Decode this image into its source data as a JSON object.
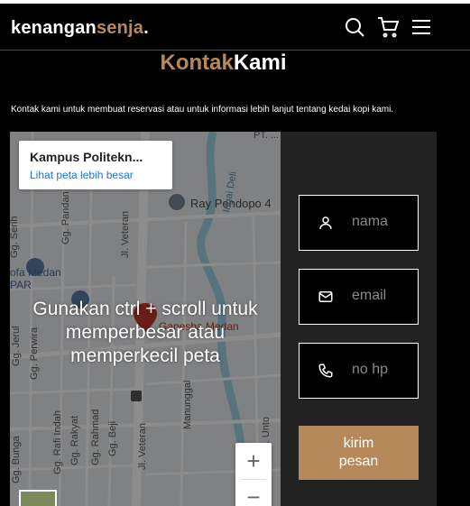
{
  "brand": {
    "part1": "kenangan",
    "part2": "senja",
    "dot": "."
  },
  "nav": {
    "icons": [
      "search-icon",
      "cart-icon",
      "menu-icon"
    ]
  },
  "page": {
    "title_part1": "Kontak",
    "title_part2": "Kami",
    "intro": "Kontak kami untuk membuat reservasi atau untuk informasi lebih lanjut tentang kedai kopi kami."
  },
  "map": {
    "place_name": "Kampus Politekn...",
    "place_link": "Lihat peta lebih besar",
    "overlay_text": "Gunakan ctrl + scroll untuk memperbesar atau memperkecil peta",
    "zoom_in": "+",
    "zoom_out": "−",
    "labels": [
      "Ray Pendopo 4",
      "Ganesha Medan",
      "Jl. Veteran",
      "Jl. Veteran",
      "Gg. Pandan",
      "Gg. Serih",
      "Gg. Perwira",
      "Gg. Rafi Indah",
      "Gg. Rakyat",
      "Gg. Rahmad",
      "Gg. Beji",
      "Gg. Unto",
      "Manunggal",
      "Gg. Jerul",
      "Gg. Bunga",
      "ofa Medan",
      "PAR",
      "Ingai Deli",
      "PT. ..."
    ]
  },
  "form": {
    "name_placeholder": "nama",
    "email_placeholder": "email",
    "phone_placeholder": "no hp",
    "submit_line1": "kirim",
    "submit_line2": "pesan"
  },
  "colors": {
    "accent": "#b6895b",
    "background": "#000000",
    "panel": "#222222",
    "link": "#1a73e8"
  }
}
